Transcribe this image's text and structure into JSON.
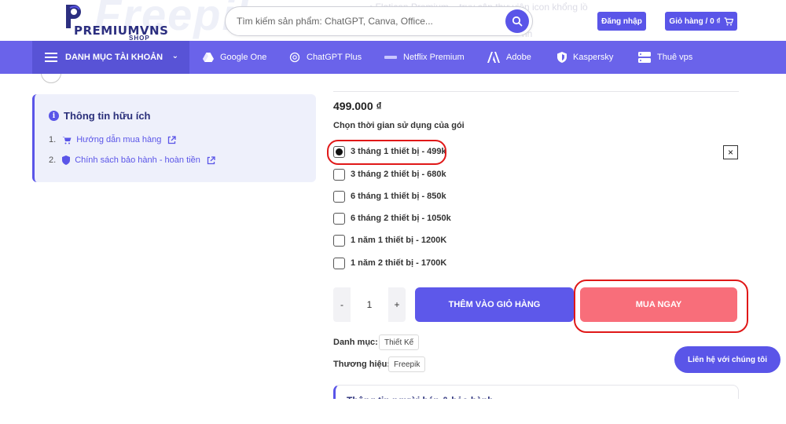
{
  "header": {
    "watermark": "Freepik",
    "ghost_text_1": "• Flaticon Premium – truy cập thư viện icon khổng lồ",
    "ghost_text_2": "nh",
    "logo": {
      "name": "PREMIUMVNS",
      "sub": "SHOP"
    },
    "search": {
      "placeholder": "Tìm kiếm sản phẩm: ChatGPT, Canva, Office..."
    },
    "login_label": "Đăng nhập",
    "cart_label": "Giỏ hàng / 0 ₫"
  },
  "nav": {
    "category_label": "DANH MỤC TÀI KHOẢN",
    "items": [
      {
        "label": "Google One",
        "icon": "google-drive-icon"
      },
      {
        "label": "ChatGPT Plus",
        "icon": "openai-icon"
      },
      {
        "label": "Netflix Premium",
        "icon": "netflix-icon"
      },
      {
        "label": "Adobe",
        "icon": "adobe-icon"
      },
      {
        "label": "Kaspersky",
        "icon": "shield-icon"
      },
      {
        "label": "Thuê vps",
        "icon": "server-icon"
      }
    ]
  },
  "info_box": {
    "title": "Thông tin hữu ích",
    "items": [
      {
        "num": "1.",
        "label": "Hướng dẫn mua hàng",
        "icon": "cart-icon"
      },
      {
        "num": "2.",
        "label": "Chính sách bảo hành - hoàn tiền",
        "icon": "shield-icon"
      }
    ]
  },
  "product": {
    "price": "499.000 ₫",
    "choose_label": "Chọn thời gian sử dụng của gói",
    "options": [
      {
        "label": "3 tháng 1 thiết bị - 499k",
        "selected": true
      },
      {
        "label": "3 tháng 2 thiết bị - 680k",
        "selected": false
      },
      {
        "label": "6 tháng 1 thiết bị - 850k",
        "selected": false
      },
      {
        "label": "6 tháng 2 thiết bị - 1050k",
        "selected": false
      },
      {
        "label": "1 năm 1 thiết bị - 1200K",
        "selected": false
      },
      {
        "label": "1 năm 2 thiết bị - 1700K",
        "selected": false
      }
    ],
    "close_symbol": "×",
    "quantity": {
      "minus": "-",
      "value": "1",
      "plus": "+"
    },
    "add_to_cart_label": "THÊM VÀO GIỎ HÀNG",
    "buy_now_label": "MUA NGAY",
    "category_label": "Danh mục:",
    "category_value": "Thiết Kế",
    "brand_label": "Thương hiệu:",
    "brand_value": "Freepik",
    "bottom_title": "Thông tin người bán & bảo hành"
  },
  "contact_label": "Liên hệ với chúng tôi",
  "colors": {
    "primary": "#5a55e8",
    "nav": "#6a63ea",
    "buy": "#f86e7a",
    "annotation": "#e01818"
  }
}
